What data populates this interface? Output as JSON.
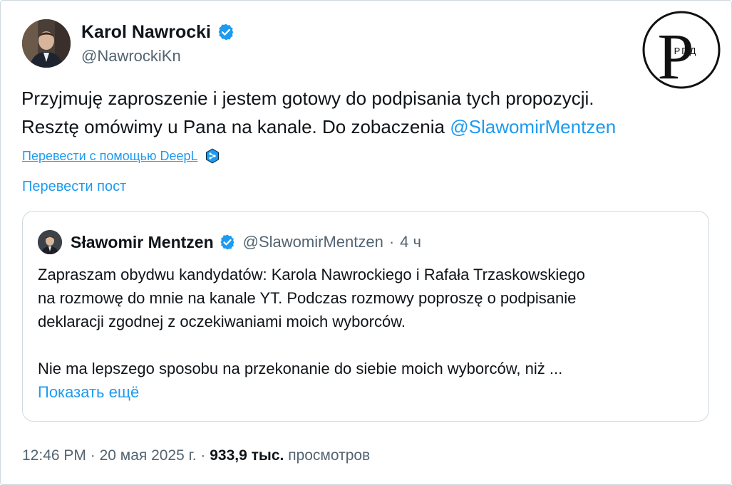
{
  "author": {
    "name": "Karol Nawrocki",
    "handle": "@NawrockiKn"
  },
  "watermark": {
    "letter": "Р",
    "sub": "РПД"
  },
  "post": {
    "line1": "Przyjmuję zaproszenie i jestem gotowy do podpisania tych propozycji.",
    "line2": "Resztę omówimy u Pana na kanale. Do zobaczenia ",
    "mention": "@SlawomirMentzen",
    "deepl_link": "Перевести с помощью DeepL",
    "translate_link": "Перевести пост"
  },
  "quote": {
    "name": "Sławomir Mentzen",
    "handle": "@SlawomirMentzen",
    "dot": "·",
    "time": "4 ч",
    "line1": "Zapraszam obydwu kandydatów: Karola Nawrockiego i Rafała Trzaskowskiego",
    "line2": "na rozmowę do mnie na kanale YT. Podczas rozmowy poproszę o podpisanie",
    "line3": "deklaracji zgodnej z oczekiwaniami moich wyborców.",
    "line4": "Nie ma lepszego sposobu na przekonanie do siebie moich wyborców, niż ...",
    "show_more": "Показать ещё"
  },
  "meta": {
    "time": "12:46 PM",
    "sep1": " · ",
    "date": "20 мая 2025 г.",
    "sep2": " · ",
    "views": "933,9 тыс.",
    "views_label": " просмотров"
  },
  "colors": {
    "accent": "#1d9bf0",
    "text": "#0f1419",
    "muted": "#536471",
    "border": "#cfd9de"
  },
  "icons": [
    "verified-badge-icon",
    "deepl-icon",
    "avatar-photo"
  ]
}
